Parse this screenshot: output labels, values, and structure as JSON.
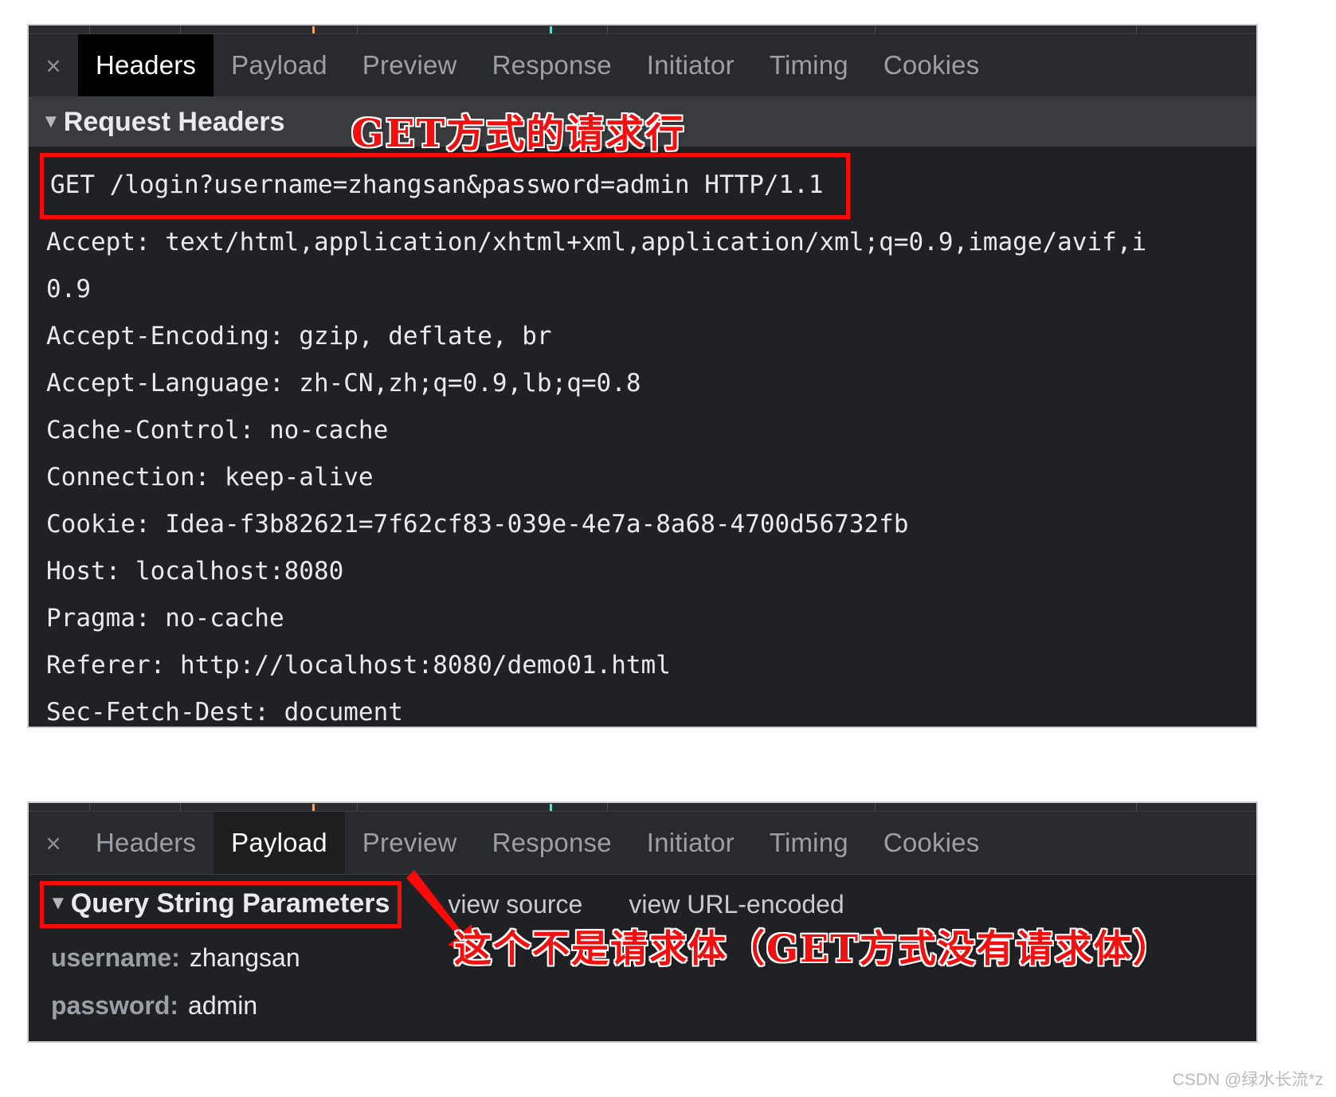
{
  "colors": {
    "panel_bg": "#202124",
    "tabbar_bg": "#292a2d",
    "section_head_bg": "#3a3b3e",
    "annotation_red": "#fb0a0a",
    "text_primary": "#e8eaed",
    "text_muted": "#9aa0a6",
    "tick_orange": "#f2a26b",
    "tick_cyan": "#5ddfd4"
  },
  "top_panel": {
    "close_icon": "×",
    "tabs": [
      {
        "label": "Headers",
        "active": true
      },
      {
        "label": "Payload",
        "active": false
      },
      {
        "label": "Preview",
        "active": false
      },
      {
        "label": "Response",
        "active": false
      },
      {
        "label": "Initiator",
        "active": false
      },
      {
        "label": "Timing",
        "active": false
      },
      {
        "label": "Cookies",
        "active": false
      }
    ],
    "section": {
      "caret": "▼",
      "title": "Request Headers"
    },
    "request_line": "GET /login?username=zhangsan&password=admin HTTP/1.1",
    "headers": [
      "Accept: text/html,application/xhtml+xml,application/xml;q=0.9,image/avif,i",
      "0.9",
      "Accept-Encoding: gzip, deflate, br",
      "Accept-Language: zh-CN,zh;q=0.9,lb;q=0.8",
      "Cache-Control: no-cache",
      "Connection: keep-alive",
      "Cookie: Idea-f3b82621=7f62cf83-039e-4e7a-8a68-4700d56732fb",
      "Host: localhost:8080",
      "Pragma: no-cache",
      "Referer: http://localhost:8080/demo01.html",
      "Sec-Fetch-Dest: document"
    ],
    "annotation": "GET方式的请求行"
  },
  "bottom_panel": {
    "close_icon": "×",
    "tabs": [
      {
        "label": "Headers",
        "active": false
      },
      {
        "label": "Payload",
        "active": true
      },
      {
        "label": "Preview",
        "active": false
      },
      {
        "label": "Response",
        "active": false
      },
      {
        "label": "Initiator",
        "active": false
      },
      {
        "label": "Timing",
        "active": false
      },
      {
        "label": "Cookies",
        "active": false
      }
    ],
    "section": {
      "caret": "▼",
      "title": "Query String Parameters"
    },
    "actions": [
      "view source",
      "view URL-encoded"
    ],
    "params": [
      {
        "key": "username:",
        "value": "zhangsan"
      },
      {
        "key": "password:",
        "value": "admin"
      }
    ],
    "annotation": "这个不是请求体（GET方式没有请求体）"
  },
  "watermark": "CSDN @绿水长流*z"
}
